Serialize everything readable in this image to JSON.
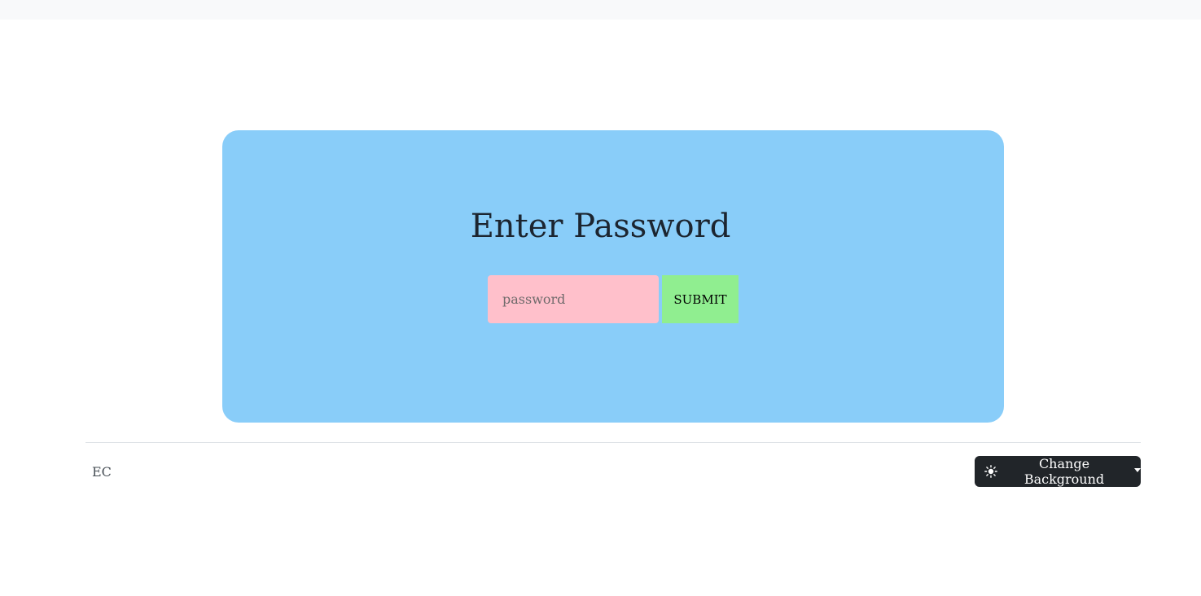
{
  "login": {
    "title": "Enter Password",
    "password_placeholder": "password",
    "password_value": "",
    "submit_label": "SUBMIT"
  },
  "footer": {
    "brand": "EC",
    "theme_button_label": "Change Background",
    "theme_button_icon": "sun-icon"
  },
  "colors": {
    "card_background": "#89cdf9",
    "input_background": "#ffc0cb",
    "submit_background": "#90ee90",
    "theme_button_background": "#212529"
  }
}
